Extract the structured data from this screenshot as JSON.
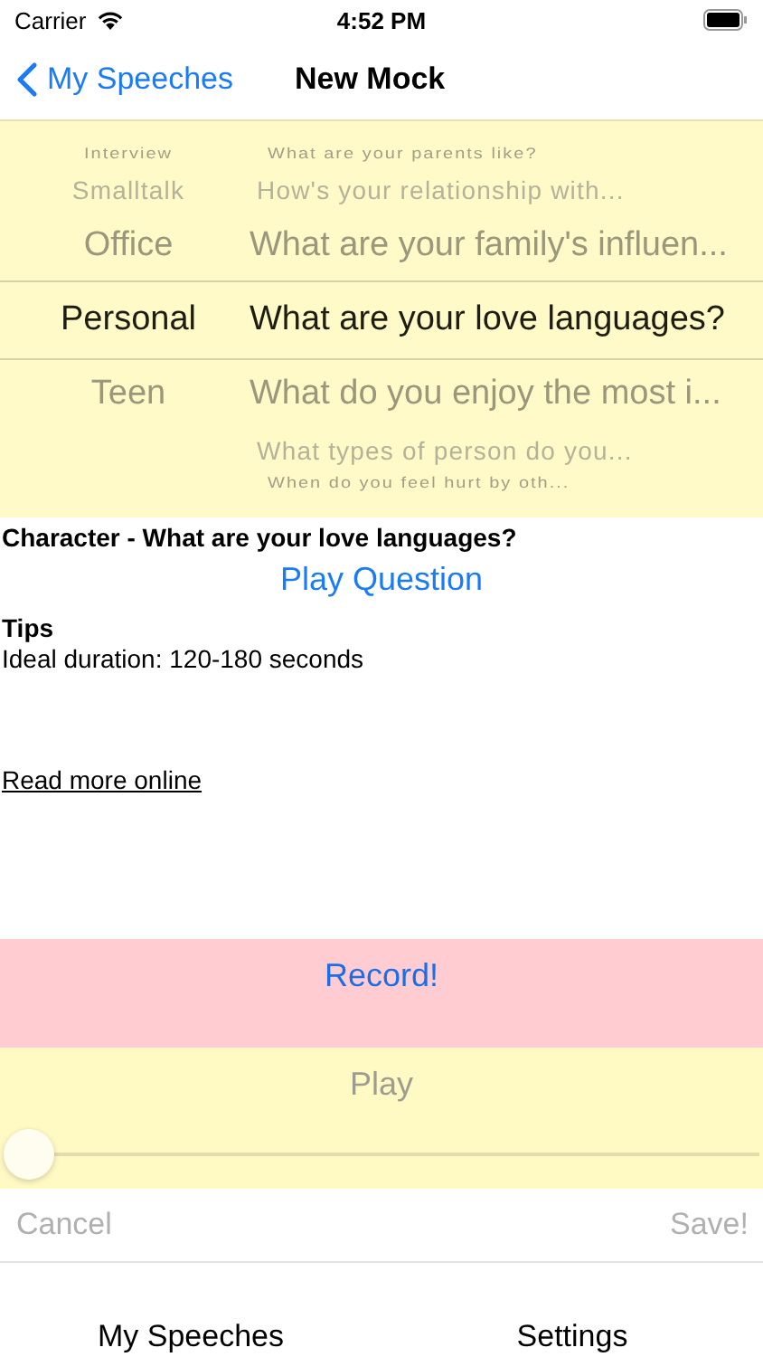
{
  "status_bar": {
    "carrier": "Carrier",
    "time": "4:52 PM"
  },
  "nav": {
    "back": "My Speeches",
    "title": "New Mock"
  },
  "picker": {
    "wheels": [
      {
        "items": [
          {
            "label": "Interview",
            "selected": false
          },
          {
            "label": "Smalltalk",
            "selected": false
          },
          {
            "label": "Office",
            "selected": false
          },
          {
            "label": "Personal",
            "selected": true
          },
          {
            "label": "Teen",
            "selected": false
          }
        ]
      },
      {
        "items": [
          {
            "label": "What are your parents like?",
            "selected": false
          },
          {
            "label": "How's your relationship with...",
            "selected": false
          },
          {
            "label": "What are your family's influen...",
            "selected": false
          },
          {
            "label": "What are your love languages?",
            "selected": true
          },
          {
            "label": "What do you enjoy the most i...",
            "selected": false
          },
          {
            "label": "What types of person do you...",
            "selected": false
          },
          {
            "label": "When do you feel hurt by oth...",
            "selected": false
          }
        ]
      }
    ]
  },
  "question": "Character - What are your love languages?",
  "play_question": "Play Question",
  "tips_heading": "Tips",
  "tips_text": "Ideal duration: 120-180 seconds",
  "read_more": "Read more online",
  "record": {
    "label": "Record!"
  },
  "play": {
    "label": "Play",
    "disabled": true
  },
  "slider": {
    "level": 0
  },
  "cancel": {
    "label": "Cancel",
    "disabled": true
  },
  "save": {
    "label": "Save!",
    "disabled": true
  },
  "tab_bar": [
    {
      "label": "My Speeches"
    },
    {
      "label": "Settings"
    }
  ]
}
